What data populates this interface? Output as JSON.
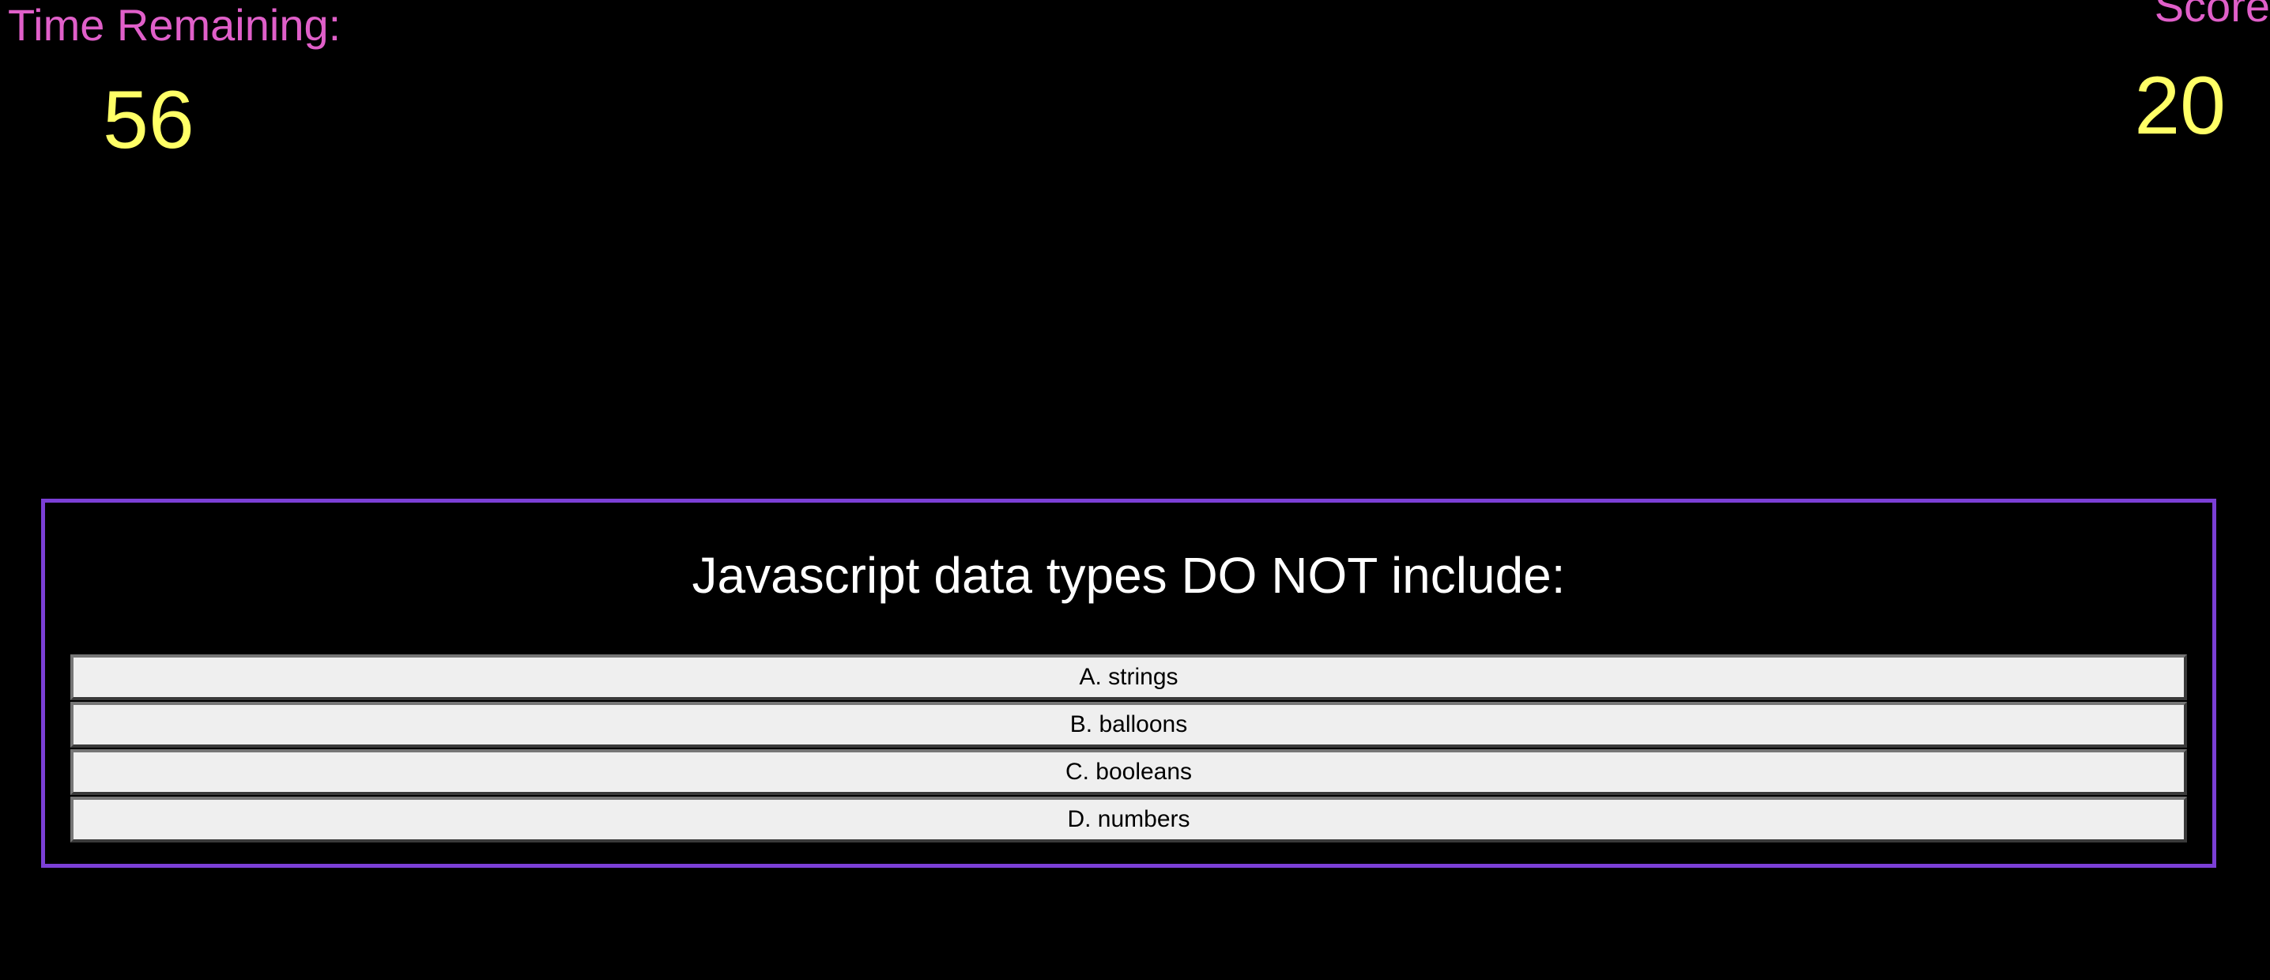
{
  "header": {
    "timer_label": "Time Remaining:",
    "timer_value": "56",
    "score_label": "Score",
    "score_value": "20"
  },
  "quiz": {
    "question": "Javascript data types DO NOT include:",
    "answers": [
      "A. strings",
      "B. balloons",
      "C. booleans",
      "D. numbers"
    ]
  },
  "colors": {
    "background": "#000000",
    "label_pink": "#e05fc9",
    "value_yellow": "#ffff66",
    "box_border_purple": "#7b3fd6",
    "question_text": "#ffffff",
    "button_bg": "#efefef"
  }
}
